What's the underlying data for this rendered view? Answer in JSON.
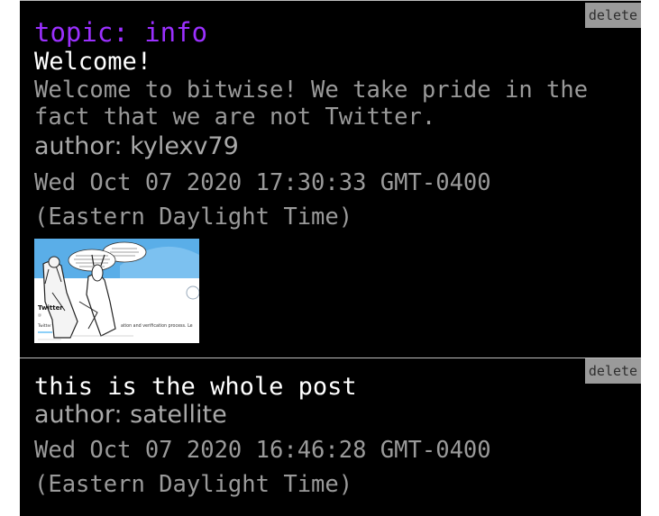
{
  "posts": [
    {
      "topic": "topic: info",
      "title": "Welcome!",
      "body": "Welcome to bitwise! We take pride in the fact that we are not Twitter.",
      "author": "author: kylexv79",
      "date": "Wed Oct 07 2020 17:30:33 GMT-0400\n(Eastern Daylight Time)",
      "delete_label": "delete",
      "image": {
        "label": "Twitter",
        "caption": "ation and verification process. Le"
      }
    },
    {
      "title": "this is the whole post",
      "author": "author: satellite",
      "date": "Wed Oct 07 2020 16:46:28 GMT-0400\n(Eastern Daylight Time)",
      "delete_label": "delete"
    }
  ],
  "colors": {
    "background": "#000000",
    "topic": "#9b30ff",
    "title": "#ffffff",
    "muted_text": "#9a9a9a",
    "delete_button": "#9a9a9a"
  }
}
